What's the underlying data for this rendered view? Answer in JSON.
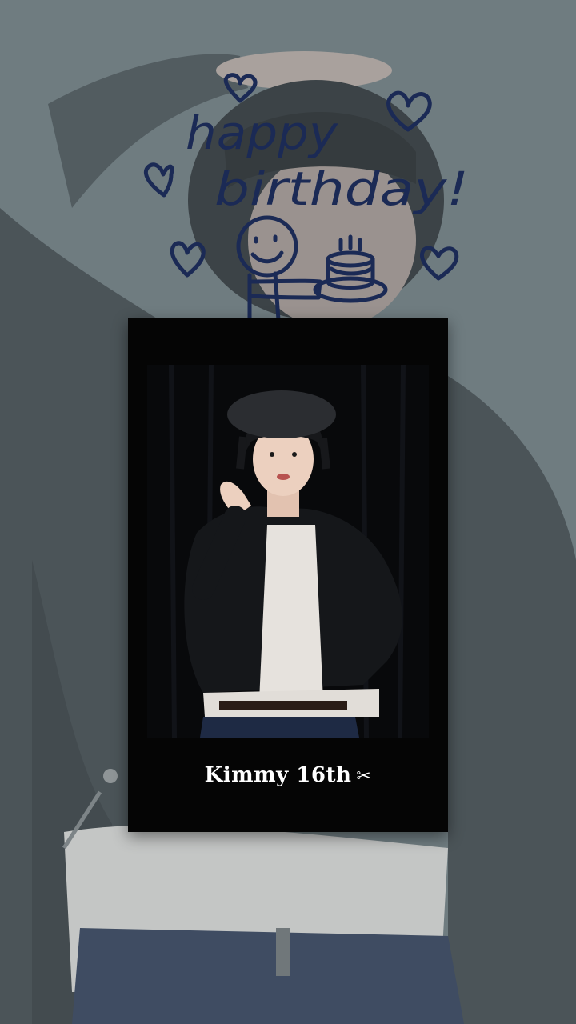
{
  "story": {
    "doodle_text_line1": "happy",
    "doodle_text_line2": "birthday!",
    "caption_name": "Kimmy 16th",
    "caption_icon": "scissors-icon",
    "caption_icon_glyph": "✂"
  },
  "colors": {
    "background_tint": "#6f7c80",
    "doodle_ink": "#1b2a55",
    "polaroid_frame": "#050505",
    "caption_text": "#ffffff"
  }
}
